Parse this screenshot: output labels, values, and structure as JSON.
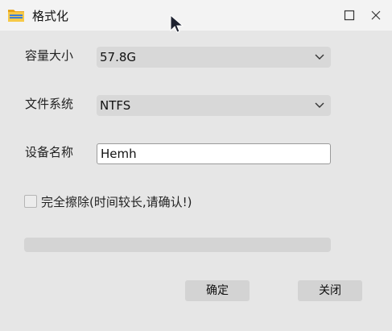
{
  "window": {
    "title": "格式化",
    "icon": "folder-icon"
  },
  "form": {
    "capacity": {
      "label": "容量大小",
      "value": "57.8G"
    },
    "filesystem": {
      "label": "文件系统",
      "value": "NTFS"
    },
    "device_name": {
      "label": "设备名称",
      "value": "Hemh"
    },
    "full_erase": {
      "label": "完全擦除(时间较长,请确认!)",
      "checked": false
    }
  },
  "progress": {
    "value": 0
  },
  "buttons": {
    "ok_label": "确定",
    "close_label": "关闭"
  }
}
